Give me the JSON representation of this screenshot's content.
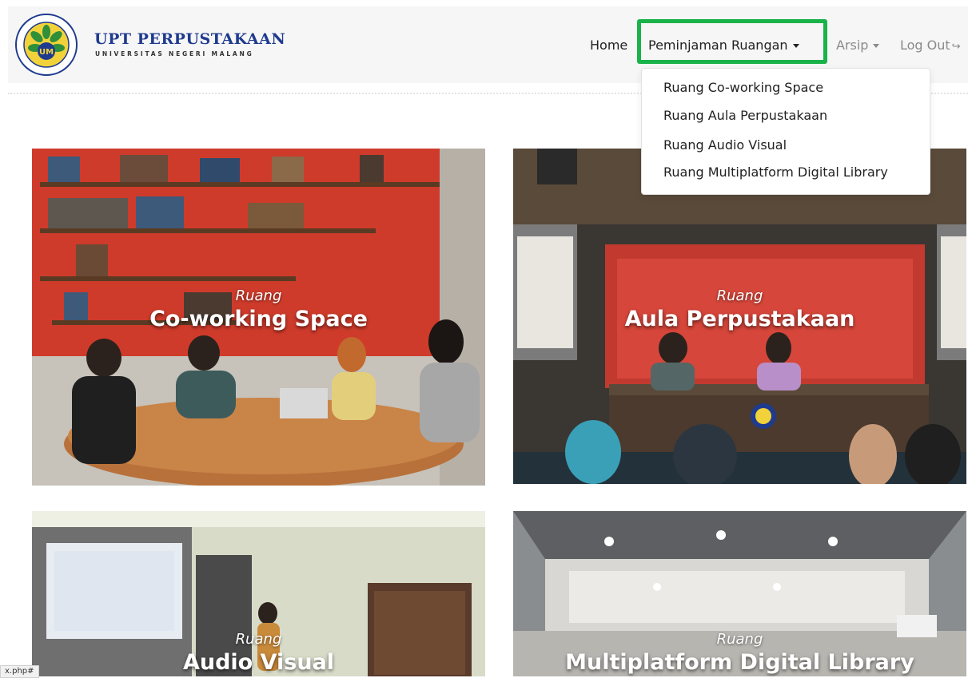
{
  "brand": {
    "title": "UPT PERPUSTAKAAN",
    "subtitle": "UNIVERSITAS NEGERI MALANG",
    "logo_name": "um-seal-logo",
    "logo_ring_text": "UNIVERSITAS NEGERI MALANG",
    "logo_center": "UM"
  },
  "nav": {
    "home": "Home",
    "peminjaman": "Peminjaman Ruangan",
    "arsip": "Arsip",
    "logout": "Log Out"
  },
  "dropdown": {
    "items": [
      "Ruang Co-working Space",
      "Ruang Aula Perpustakaan",
      "Ruang Audio Visual",
      "Ruang Multiplatform Digital Library"
    ]
  },
  "cards": [
    {
      "pre": "Ruang",
      "label": "Co-working Space"
    },
    {
      "pre": "Ruang",
      "label": "Aula Perpustakaan"
    },
    {
      "pre": "Ruang",
      "label": "Audio Visual"
    },
    {
      "pre": "Ruang",
      "label": "Multiplatform Digital Library"
    }
  ],
  "status_bar": {
    "url": "x.php#"
  },
  "colors": {
    "highlight": "#19b34a",
    "brand_blue": "#1f3b8e",
    "navbar_bg": "#f6f6f6"
  }
}
